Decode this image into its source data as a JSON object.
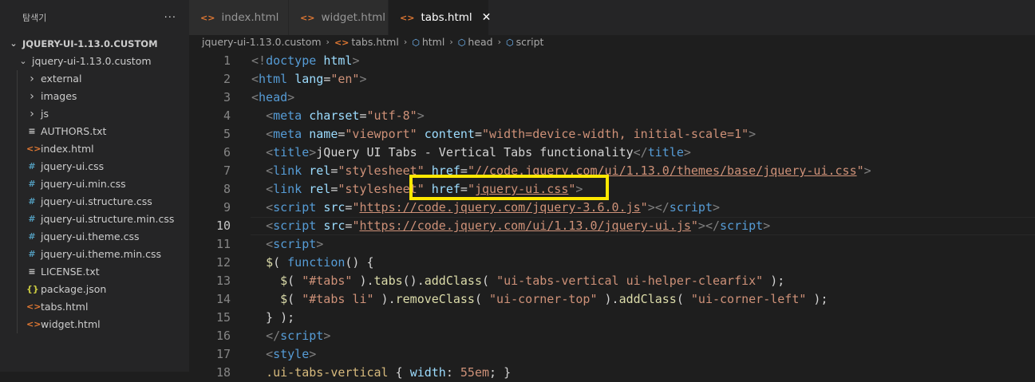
{
  "sidebar": {
    "title": "탐색기",
    "more_label": "···",
    "root": "JQUERY-UI-1.13.0.CUSTOM",
    "folder": "jquery-ui-1.13.0.custom",
    "items": [
      {
        "label": "external",
        "kind": "folder"
      },
      {
        "label": "images",
        "kind": "folder"
      },
      {
        "label": "js",
        "kind": "folder"
      },
      {
        "label": "AUTHORS.txt",
        "kind": "text"
      },
      {
        "label": "index.html",
        "kind": "html"
      },
      {
        "label": "jquery-ui.css",
        "kind": "css"
      },
      {
        "label": "jquery-ui.min.css",
        "kind": "css"
      },
      {
        "label": "jquery-ui.structure.css",
        "kind": "css"
      },
      {
        "label": "jquery-ui.structure.min.css",
        "kind": "css"
      },
      {
        "label": "jquery-ui.theme.css",
        "kind": "css"
      },
      {
        "label": "jquery-ui.theme.min.css",
        "kind": "css"
      },
      {
        "label": "LICENSE.txt",
        "kind": "text"
      },
      {
        "label": "package.json",
        "kind": "json"
      },
      {
        "label": "tabs.html",
        "kind": "html"
      },
      {
        "label": "widget.html",
        "kind": "html"
      }
    ]
  },
  "tabs": [
    {
      "label": "index.html",
      "active": false
    },
    {
      "label": "widget.html",
      "active": false
    },
    {
      "label": "tabs.html",
      "active": true
    }
  ],
  "breadcrumb": [
    "jquery-ui-1.13.0.custom",
    "tabs.html",
    "html",
    "head",
    "script"
  ],
  "current_line": 10,
  "code_lines": [
    {
      "n": "1",
      "tokens": [
        [
          "punc",
          "<!"
        ],
        [
          "tag",
          "doctype"
        ],
        [
          "txt",
          " "
        ],
        [
          "attr",
          "html"
        ],
        [
          "punc",
          ">"
        ]
      ]
    },
    {
      "n": "2",
      "tokens": [
        [
          "punc",
          "<"
        ],
        [
          "tag",
          "html"
        ],
        [
          "txt",
          " "
        ],
        [
          "attr",
          "lang"
        ],
        [
          "txt",
          "="
        ],
        [
          "str",
          "\"en\""
        ],
        [
          "punc",
          ">"
        ]
      ]
    },
    {
      "n": "3",
      "tokens": [
        [
          "punc",
          "<"
        ],
        [
          "tag",
          "head"
        ],
        [
          "punc",
          ">"
        ]
      ]
    },
    {
      "n": "4",
      "tokens": [
        [
          "txt",
          "  "
        ],
        [
          "punc",
          "<"
        ],
        [
          "tag",
          "meta"
        ],
        [
          "txt",
          " "
        ],
        [
          "attr",
          "charset"
        ],
        [
          "txt",
          "="
        ],
        [
          "str",
          "\"utf-8\""
        ],
        [
          "punc",
          ">"
        ]
      ]
    },
    {
      "n": "5",
      "tokens": [
        [
          "txt",
          "  "
        ],
        [
          "punc",
          "<"
        ],
        [
          "tag",
          "meta"
        ],
        [
          "txt",
          " "
        ],
        [
          "attr",
          "name"
        ],
        [
          "txt",
          "="
        ],
        [
          "str",
          "\"viewport\""
        ],
        [
          "txt",
          " "
        ],
        [
          "attr",
          "content"
        ],
        [
          "txt",
          "="
        ],
        [
          "str",
          "\"width=device-width, initial-scale=1\""
        ],
        [
          "punc",
          ">"
        ]
      ]
    },
    {
      "n": "6",
      "tokens": [
        [
          "txt",
          "  "
        ],
        [
          "punc",
          "<"
        ],
        [
          "tag",
          "title"
        ],
        [
          "punc",
          ">"
        ],
        [
          "txt",
          "jQuery UI Tabs - Vertical Tabs functionality"
        ],
        [
          "punc",
          "</"
        ],
        [
          "tag",
          "title"
        ],
        [
          "punc",
          ">"
        ]
      ]
    },
    {
      "n": "7",
      "tokens": [
        [
          "txt",
          "  "
        ],
        [
          "punc",
          "<"
        ],
        [
          "tag",
          "link"
        ],
        [
          "txt",
          " "
        ],
        [
          "attr",
          "rel"
        ],
        [
          "txt",
          "="
        ],
        [
          "str",
          "\"stylesheet\""
        ],
        [
          "txt",
          " "
        ],
        [
          "attr",
          "href"
        ],
        [
          "txt",
          "="
        ],
        [
          "str",
          "\""
        ],
        [
          "link",
          "//code.jquery.com/ui/1.13.0/themes/base/jquery-ui.css"
        ],
        [
          "str",
          "\""
        ],
        [
          "punc",
          ">"
        ]
      ]
    },
    {
      "n": "8",
      "tokens": [
        [
          "txt",
          "  "
        ],
        [
          "punc",
          "<"
        ],
        [
          "tag",
          "link"
        ],
        [
          "txt",
          " "
        ],
        [
          "attr",
          "rel"
        ],
        [
          "txt",
          "="
        ],
        [
          "str",
          "\"stylesheet\""
        ],
        [
          "txt",
          " "
        ],
        [
          "attr",
          "href"
        ],
        [
          "txt",
          "="
        ],
        [
          "str",
          "\""
        ],
        [
          "link",
          "jquery-ui.css"
        ],
        [
          "str",
          "\""
        ],
        [
          "punc",
          ">"
        ]
      ]
    },
    {
      "n": "9",
      "tokens": [
        [
          "txt",
          "  "
        ],
        [
          "punc",
          "<"
        ],
        [
          "tag",
          "script"
        ],
        [
          "txt",
          " "
        ],
        [
          "attr",
          "src"
        ],
        [
          "txt",
          "="
        ],
        [
          "str",
          "\""
        ],
        [
          "link",
          "https://code.jquery.com/jquery-3.6.0.js"
        ],
        [
          "str",
          "\""
        ],
        [
          "punc",
          "></"
        ],
        [
          "tag",
          "script"
        ],
        [
          "punc",
          ">"
        ]
      ]
    },
    {
      "n": "10",
      "tokens": [
        [
          "txt",
          "  "
        ],
        [
          "punc",
          "<"
        ],
        [
          "tag",
          "script"
        ],
        [
          "txt",
          " "
        ],
        [
          "attr",
          "src"
        ],
        [
          "txt",
          "="
        ],
        [
          "str",
          "\""
        ],
        [
          "link",
          "https://code.jquery.com/ui/1.13.0/jquery-ui.js"
        ],
        [
          "str",
          "\""
        ],
        [
          "punc",
          "></"
        ],
        [
          "tag",
          "script"
        ],
        [
          "punc",
          ">"
        ]
      ]
    },
    {
      "n": "11",
      "tokens": [
        [
          "txt",
          "  "
        ],
        [
          "punc",
          "<"
        ],
        [
          "tag",
          "script"
        ],
        [
          "punc",
          ">"
        ]
      ]
    },
    {
      "n": "12",
      "tokens": [
        [
          "txt",
          "  "
        ],
        [
          "fn",
          "$"
        ],
        [
          "txt",
          "( "
        ],
        [
          "kw",
          "function"
        ],
        [
          "txt",
          "() {"
        ]
      ]
    },
    {
      "n": "13",
      "tokens": [
        [
          "txt",
          "    "
        ],
        [
          "fn",
          "$"
        ],
        [
          "txt",
          "( "
        ],
        [
          "str",
          "\"#tabs\""
        ],
        [
          "txt",
          " )."
        ],
        [
          "fn",
          "tabs"
        ],
        [
          "txt",
          "()."
        ],
        [
          "fn",
          "addClass"
        ],
        [
          "txt",
          "( "
        ],
        [
          "str",
          "\"ui-tabs-vertical ui-helper-clearfix\""
        ],
        [
          "txt",
          " );"
        ]
      ]
    },
    {
      "n": "14",
      "tokens": [
        [
          "txt",
          "    "
        ],
        [
          "fn",
          "$"
        ],
        [
          "txt",
          "( "
        ],
        [
          "str",
          "\"#tabs li\""
        ],
        [
          "txt",
          " )."
        ],
        [
          "fn",
          "removeClass"
        ],
        [
          "txt",
          "( "
        ],
        [
          "str",
          "\"ui-corner-top\""
        ],
        [
          "txt",
          " )."
        ],
        [
          "fn",
          "addClass"
        ],
        [
          "txt",
          "( "
        ],
        [
          "str",
          "\"ui-corner-left\""
        ],
        [
          "txt",
          " );"
        ]
      ]
    },
    {
      "n": "15",
      "tokens": [
        [
          "txt",
          "  } );"
        ]
      ]
    },
    {
      "n": "16",
      "tokens": [
        [
          "txt",
          "  "
        ],
        [
          "punc",
          "</"
        ],
        [
          "tag",
          "script"
        ],
        [
          "punc",
          ">"
        ]
      ]
    },
    {
      "n": "17",
      "tokens": [
        [
          "txt",
          "  "
        ],
        [
          "punc",
          "<"
        ],
        [
          "tag",
          "style"
        ],
        [
          "punc",
          ">"
        ]
      ]
    },
    {
      "n": "18",
      "tokens": [
        [
          "txt",
          "  "
        ],
        [
          "sel",
          ".ui-tabs-vertical"
        ],
        [
          "txt",
          " { "
        ],
        [
          "attr",
          "width"
        ],
        [
          "txt",
          ": "
        ],
        [
          "str",
          "55em"
        ],
        [
          "txt",
          "; }"
        ]
      ]
    }
  ],
  "colors": {
    "highlight_box": "#ffe800",
    "accent_orange": "#e37933",
    "css_icon_blue": "#519aba",
    "json_icon_yellow": "#cbcb41"
  }
}
